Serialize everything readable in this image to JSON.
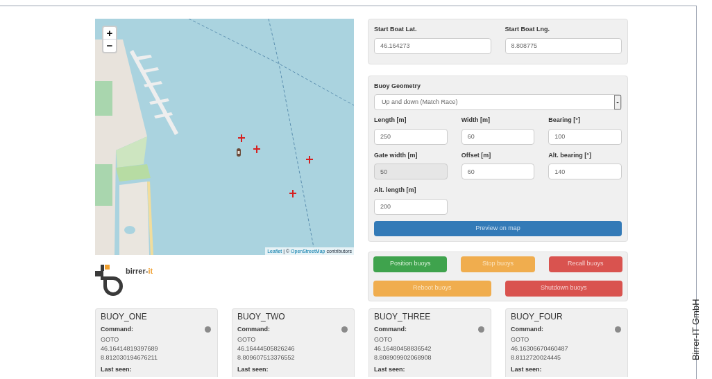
{
  "map": {
    "kind": "picture",
    "zoom_in": "+",
    "zoom_out": "−",
    "attribution_link": "Leaflet",
    "attribution_sep": " | © ",
    "attribution_osm": "OpenStreetMap",
    "attribution_tail": " contributors"
  },
  "logo": {
    "text_main": "birrer-",
    "text_accent": "it"
  },
  "start": {
    "fields": [
      {
        "label": "Start Boat Lat.",
        "value": "46.164273"
      },
      {
        "label": "Start Boat Lng.",
        "value": "8.808775"
      }
    ]
  },
  "geometry": {
    "label": "Buoy Geometry",
    "select": "Up and down (Match Race)",
    "fields": [
      {
        "label": "Length [m]",
        "value": "250",
        "disabled": false
      },
      {
        "label": "Width [m]",
        "value": "60",
        "disabled": false
      },
      {
        "label": "Bearing [°]",
        "value": "100",
        "disabled": false
      },
      {
        "label": "Gate width [m]",
        "value": "50",
        "disabled": true
      },
      {
        "label": "Offset [m]",
        "value": "60",
        "disabled": false
      },
      {
        "label": "Alt. bearing [°]",
        "value": "140",
        "disabled": false
      },
      {
        "label": "Alt. length [m]",
        "value": "200",
        "disabled": false
      }
    ],
    "preview_button": "Preview on map"
  },
  "actions": [
    [
      {
        "label": "Position buoys",
        "kind": "success"
      },
      {
        "label": "Stop buoys",
        "kind": "warning"
      },
      {
        "label": "Recall buoys",
        "kind": "danger"
      }
    ],
    [
      {
        "label": "Reboot buoys",
        "kind": "warning"
      },
      {
        "label": "Shutdown buoys",
        "kind": "danger"
      }
    ]
  ],
  "buoys": [
    {
      "name": "BUOY_ONE",
      "command_label": "Command:",
      "command": "GOTO",
      "lat": "46.16414819397689",
      "lng": "8.812030194676211",
      "last_seen": "Last seen:",
      "color": "#8a8a8a"
    },
    {
      "name": "BUOY_TWO",
      "command_label": "Command:",
      "command": "GOTO",
      "lat": "46.16444505826246",
      "lng": "8.809607513376552",
      "last_seen": "Last seen:",
      "color": "#8a8a8a"
    },
    {
      "name": "BUOY_THREE",
      "command_label": "Command:",
      "command": "GOTO",
      "lat": "46.16480458836542",
      "lng": "8.808909902068908",
      "last_seen": "Last seen:",
      "color": "#8a8a8a"
    },
    {
      "name": "BUOY_FOUR",
      "command_label": "Command:",
      "command": "GOTO",
      "lat": "46.16306670460487",
      "lng": "8.8112720024445",
      "last_seen": "Last seen:",
      "color": "#8a8a8a"
    }
  ],
  "caption": "Birrer-IT GmbH"
}
